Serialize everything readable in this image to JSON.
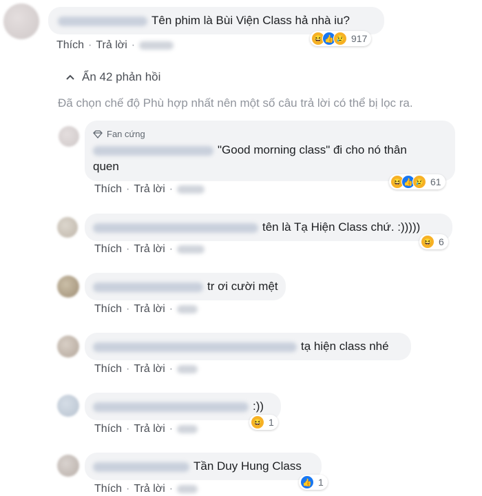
{
  "action_like": "Thích",
  "action_reply": "Trả lời",
  "hide_replies": "Ẩn 42 phản hồi",
  "filter_notice": "Đã chọn chế độ Phù hợp nhất nên một số câu trả lời có thể bị lọc ra.",
  "fan_badge": "Fan cứng",
  "comments": [
    {
      "text": "Tên phim là Bùi Viện Class hả nhà iu?",
      "reaction_count": "917",
      "reactions": [
        "haha",
        "like",
        "sad"
      ]
    },
    {
      "text_line1": "\"Good morning class\" đi cho nó thân",
      "text_line2": "quen",
      "reaction_count": "61",
      "reactions": [
        "haha",
        "like",
        "sad"
      ]
    },
    {
      "text": "tên là Tạ Hiện Class chứ. :)))))",
      "reaction_count": "6",
      "reactions": [
        "haha"
      ]
    },
    {
      "text": "tr ơi cười mệt"
    },
    {
      "text": "tạ hiện class nhé"
    },
    {
      "text": ":))",
      "reaction_count": "1",
      "reactions": [
        "haha"
      ]
    },
    {
      "text": "Tần Duy Hung Class",
      "reaction_count": "1",
      "reactions": [
        "like"
      ]
    }
  ],
  "colors": {
    "link": "#4b4f56",
    "like_blue": "#1877f2",
    "haha_yellow": "#f7b125",
    "bubble": "#f2f3f5"
  },
  "icons": {
    "diamond": "diamond-icon",
    "chevron": "chevron-up-icon"
  }
}
